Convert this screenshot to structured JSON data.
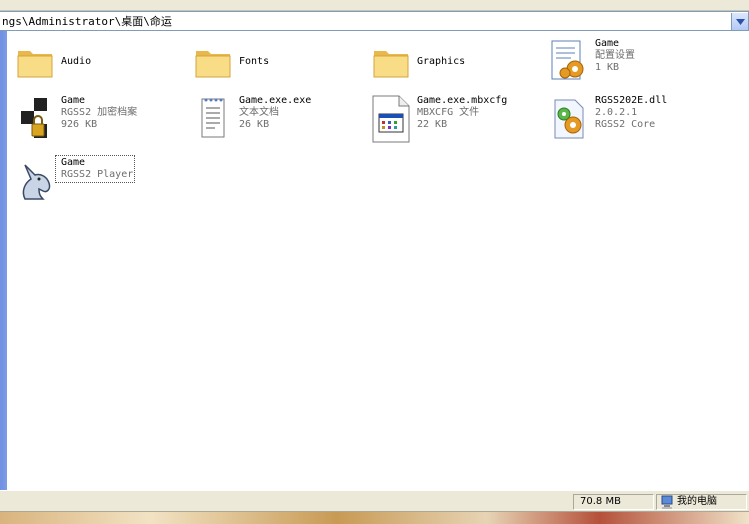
{
  "address": {
    "path": "ngs\\Administrator\\桌面\\命运"
  },
  "items": [
    {
      "name": "Audio",
      "icon": "folder-icon"
    },
    {
      "name": "Fonts",
      "icon": "folder-icon"
    },
    {
      "name": "Graphics",
      "icon": "folder-icon"
    },
    {
      "name": "Game",
      "sub1": "配置设置",
      "sub2": "1 KB",
      "icon": "config-settings-icon"
    },
    {
      "name": "Game",
      "sub1": "RGSS2 加密档案",
      "sub2": "926 KB",
      "icon": "encrypted-archive-icon"
    },
    {
      "name": "Game.exe.exe",
      "sub1": "文本文档",
      "sub2": "26 KB",
      "icon": "text-document-icon"
    },
    {
      "name": "Game.exe.mbxcfg",
      "sub1": "MBXCFG 文件",
      "sub2": "22 KB",
      "icon": "mbxcfg-file-icon"
    },
    {
      "name": "RGSS202E.dll",
      "sub1": "2.0.2.1",
      "sub2": "RGSS2 Core",
      "icon": "dll-file-icon"
    },
    {
      "name": "Game",
      "sub1": "RGSS2 Player",
      "icon": "unicorn-app-icon"
    }
  ],
  "status": {
    "size": "70.8 MB",
    "zone": "我的电脑",
    "zone_icon": "my-computer-icon"
  },
  "colors": {
    "folder": "#f6d47a",
    "selection_outline": "#555555",
    "left_pane": "#7d9ce8"
  }
}
